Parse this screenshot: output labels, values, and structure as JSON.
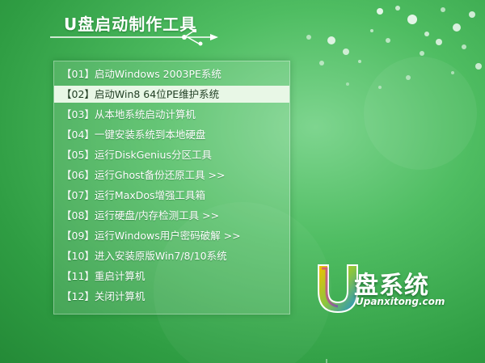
{
  "header": {
    "title": "U盘启动制作工具"
  },
  "menu": {
    "selected_index": 1,
    "items": [
      {
        "label": "【01】启动Windows 2003PE系统"
      },
      {
        "label": "【02】启动Win8 64位PE维护系统"
      },
      {
        "label": "【03】从本地系统启动计算机"
      },
      {
        "label": "【04】一键安装系统到本地硬盘"
      },
      {
        "label": "【05】运行DiskGenius分区工具"
      },
      {
        "label": "【06】运行Ghost备份还原工具 >>"
      },
      {
        "label": "【07】运行MaxDos增强工具箱"
      },
      {
        "label": "【08】运行硬盘/内存检测工具 >>"
      },
      {
        "label": "【09】运行Windows用户密码破解 >>"
      },
      {
        "label": "【10】进入安装原版Win7/8/10系统"
      },
      {
        "label": "【11】重启计算机"
      },
      {
        "label": "【12】关闭计算机"
      }
    ]
  },
  "logo": {
    "name": "盘系统",
    "url": "Upanxitong.com",
    "icon": "u-shape-logo-icon"
  },
  "colors": {
    "background": "#3fae52",
    "selected_row": "#e8f7e6",
    "text": "#ffffff"
  }
}
